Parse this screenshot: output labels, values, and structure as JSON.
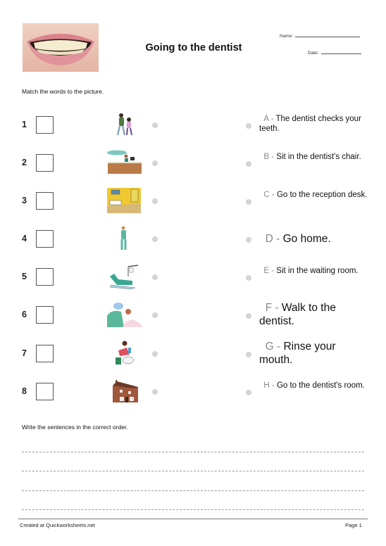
{
  "header": {
    "title": "Going to the dentist",
    "name_label": "Name:",
    "date_label": "Date:",
    "image": "smiling-mouth-photo"
  },
  "instructions": {
    "match": "Match the words to the picture.",
    "write": "Write the sentences in the correct order."
  },
  "items": [
    {
      "number": "1",
      "picture": "walking-people-icon"
    },
    {
      "number": "2",
      "picture": "reception-desk-icon"
    },
    {
      "number": "3",
      "picture": "waiting-room-icon"
    },
    {
      "number": "4",
      "picture": "dentist-standing-icon"
    },
    {
      "number": "5",
      "picture": "dentist-chair-icon"
    },
    {
      "number": "6",
      "picture": "dentist-checking-teeth-icon"
    },
    {
      "number": "7",
      "picture": "rinse-mouth-icon"
    },
    {
      "number": "8",
      "picture": "house-icon"
    }
  ],
  "options": [
    {
      "letter": "A -",
      "text": "The dentist checks your teeth."
    },
    {
      "letter": "B -",
      "text": "Sit in the dentist's chair."
    },
    {
      "letter": "C -",
      "text": "Go to the reception desk."
    },
    {
      "letter": "D -",
      "text": "Go home."
    },
    {
      "letter": "E -",
      "text": "Sit in the waiting room."
    },
    {
      "letter": "F -",
      "text": "Walk to the dentist."
    },
    {
      "letter": "G -",
      "text": "Rinse your mouth."
    },
    {
      "letter": "H -",
      "text": "Go to the dentist's room."
    }
  ],
  "writing_lines": 4,
  "footer": {
    "left": "Created at Quickworksheets.net",
    "right": "Page 1"
  },
  "colors": {
    "dot": "#d4d4d4",
    "letter": "#888888"
  }
}
